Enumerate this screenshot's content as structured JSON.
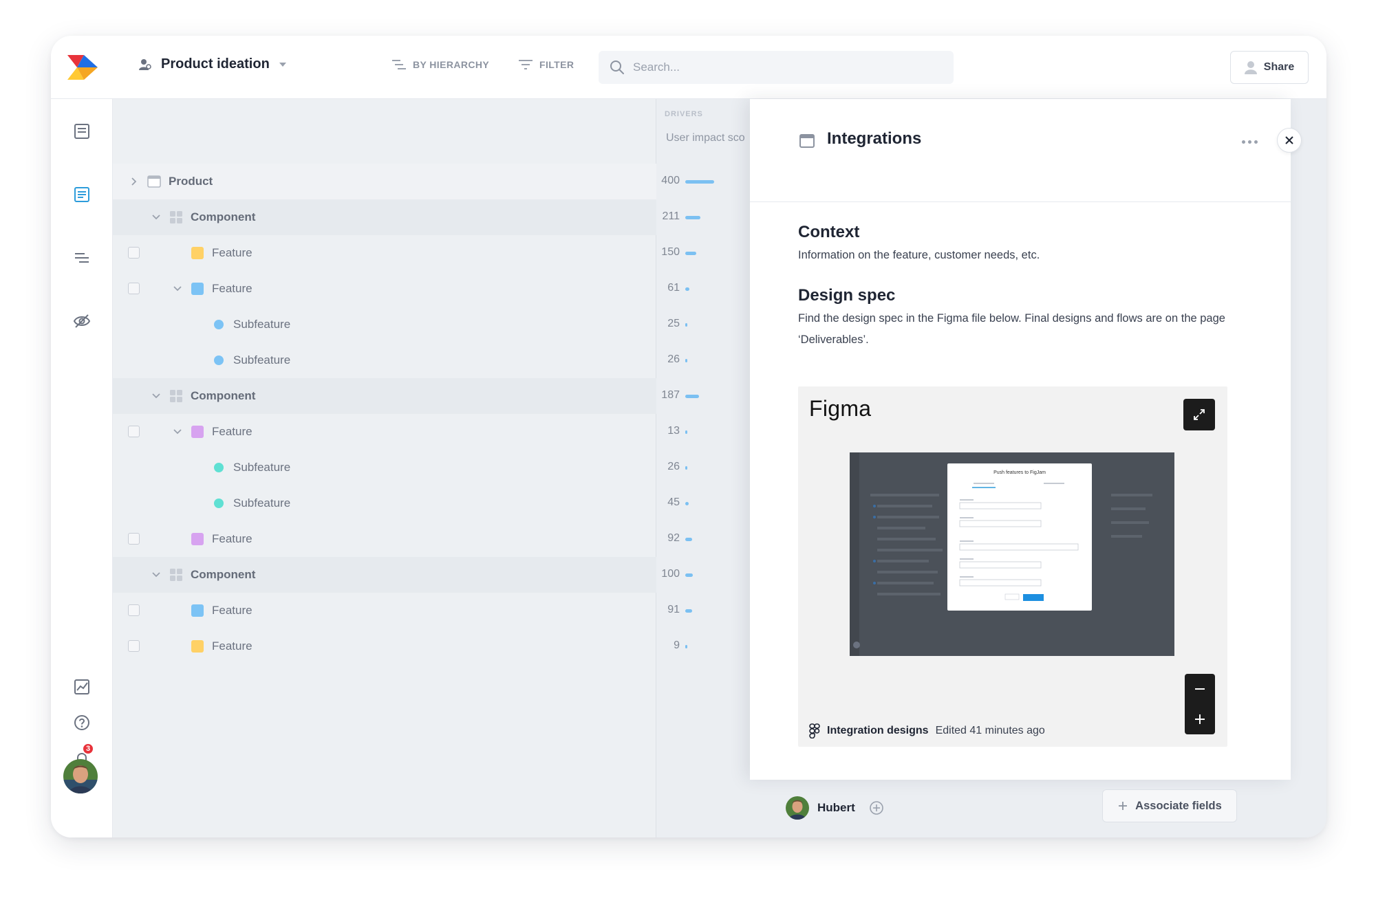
{
  "topbar": {
    "workspace_title": "Product ideation",
    "by_hierarchy": "BY HIERARCHY",
    "filter": "FILTER",
    "search_placeholder": "Search...",
    "share": "Share"
  },
  "sidebar": {
    "notification_count": "3"
  },
  "table": {
    "drivers_label": "DRIVERS",
    "column_header": "User impact sco",
    "max_value": 400,
    "rows": [
      {
        "label": "Product",
        "type": "product",
        "value": "400"
      },
      {
        "label": "Component",
        "type": "component",
        "value": "211"
      },
      {
        "label": "Feature",
        "type": "feature",
        "color": "#ffd166",
        "value": "150"
      },
      {
        "label": "Feature",
        "type": "feature",
        "color": "#7cc3f5",
        "value": "61"
      },
      {
        "label": "Subfeature",
        "type": "subfeature",
        "color": "#7cc3f5",
        "value": "25"
      },
      {
        "label": "Subfeature",
        "type": "subfeature",
        "color": "#7cc3f5",
        "value": "26"
      },
      {
        "label": "Component",
        "type": "component",
        "value": "187"
      },
      {
        "label": "Feature",
        "type": "feature",
        "color": "#d7a3f0",
        "value": "13"
      },
      {
        "label": "Subfeature",
        "type": "subfeature",
        "color": "#5fe0d3",
        "value": "26"
      },
      {
        "label": "Subfeature",
        "type": "subfeature",
        "color": "#5fe0d3",
        "value": "45"
      },
      {
        "label": "Feature",
        "type": "feature",
        "color": "#d7a3f0",
        "value": "92"
      },
      {
        "label": "Component",
        "type": "component",
        "value": "100"
      },
      {
        "label": "Feature",
        "type": "feature",
        "color": "#7cc3f5",
        "value": "91"
      },
      {
        "label": "Feature",
        "type": "feature",
        "color": "#ffd166",
        "value": "9"
      }
    ]
  },
  "detail": {
    "title": "Integrations",
    "context_heading": "Context",
    "context_text": "Information on the feature, customer needs, etc.",
    "spec_heading": "Design spec",
    "spec_text": "Find the design spec in the Figma file below. Final designs and flows are on the page ‘Deliverables’.",
    "embed": {
      "brand": "Figma",
      "modal_title": "Push features to FigJam",
      "file_name": "Integration designs",
      "edited": "Edited 41 minutes ago"
    },
    "owner_name": "Hubert",
    "associate_fields": "Associate fields"
  },
  "colors": {
    "accent": "#2d9cdb",
    "bar": "#7bc0f2",
    "close_accent": "#1f2533"
  }
}
